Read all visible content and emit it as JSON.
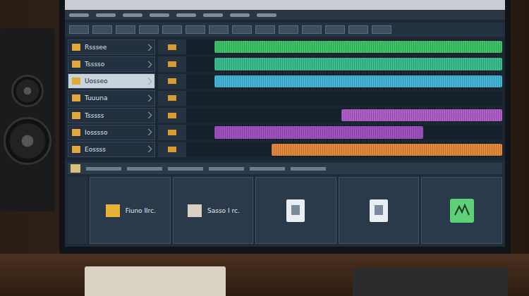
{
  "sidebar": {
    "items": [
      {
        "label": "Rsssee",
        "selected": false
      },
      {
        "label": "Tsssso",
        "selected": false
      },
      {
        "label": "Uosseo",
        "selected": true
      },
      {
        "label": "Tuuuna",
        "selected": false
      },
      {
        "label": "Tsssss",
        "selected": false
      },
      {
        "label": "Iosssso",
        "selected": false
      },
      {
        "label": "Eossss",
        "selected": false
      }
    ]
  },
  "tracks": [
    {
      "color": "#3fc46a",
      "start": 0.09,
      "level": 0.91
    },
    {
      "color": "#3bbf8e",
      "start": 0.09,
      "level": 0.91
    },
    {
      "color": "#46b6d8",
      "start": 0.09,
      "level": 0.91
    },
    {
      "color": "#1e2a36",
      "start": 0,
      "level": 0
    },
    {
      "color": "#b05fc8",
      "start": 0.49,
      "level": 0.51
    },
    {
      "color": "#a052c0",
      "start": 0.09,
      "level": 0.66
    },
    {
      "color": "#e58a3c",
      "start": 0.27,
      "level": 0.73
    }
  ],
  "cards": [
    {
      "label": "Fiuno Ilrc.",
      "kind": "folder",
      "color": "#e8b23a"
    },
    {
      "label": "Sasso I rc.",
      "kind": "folder",
      "color": "#d8cfc2"
    },
    {
      "kind": "doc",
      "color": "#e9eef4"
    },
    {
      "kind": "doc",
      "color": "#e9eef4"
    },
    {
      "kind": "wave",
      "color": "#5fd07a"
    }
  ]
}
